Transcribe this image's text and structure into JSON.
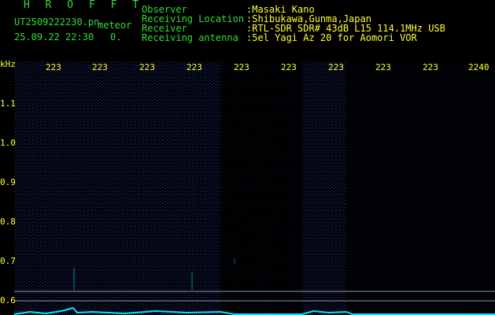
{
  "header": {
    "program": "H R O F F T",
    "filename": "UT2509222230.pn",
    "mode": "meteor",
    "date_time": "25.09.22 22:30",
    "count": "0."
  },
  "info": {
    "observer_label": "Observer",
    "observer_value": ":Masaki Kano",
    "location_label": "Receiving Location",
    "location_value": ":Shibukawa,Gunma,Japan",
    "receiver_label": "Receiver",
    "receiver_value": ":RTL-SDR SDR# 43dB L15 114.1MHz USB",
    "antenna_label": "Receiving antenna",
    "antenna_value": ":5el Yagi Az 20 for Aomori VOR"
  },
  "axis": {
    "unit": "kHz",
    "y_ticks": [
      "1.1",
      "1.0",
      "0.9",
      "0.8",
      "0.7",
      "0.6"
    ],
    "x_ticks": [
      "223",
      "223",
      "223",
      "223",
      "223",
      "223",
      "223",
      "223",
      "223",
      "2240"
    ]
  },
  "colors": {
    "background": "#000000",
    "header_text": "#33dd33",
    "info_text": "#ffff33",
    "noise": "#2a3fb0",
    "echo": "#00e5ff"
  }
}
